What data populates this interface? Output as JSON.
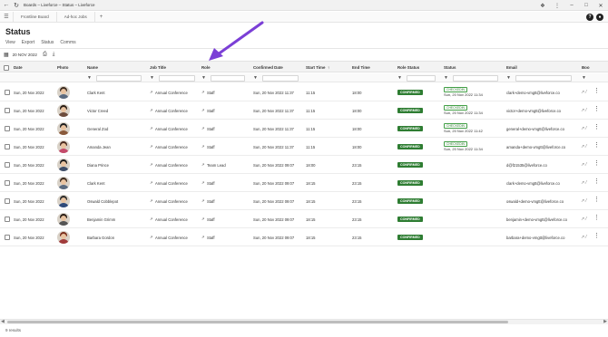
{
  "browser": {
    "title": "Boards – Liveforce – Status – Liveforce"
  },
  "app_tabs": [
    "Frontline Board",
    "Ad-hoc Jobs"
  ],
  "page": {
    "title": "Status",
    "subnav": [
      "View",
      "Export",
      "Status",
      "Comms"
    ],
    "date_filter": "20 NOV 2022"
  },
  "columns": [
    "Date",
    "Photo",
    "Name",
    "Job Title",
    "Role",
    "Confirmed Date",
    "Start Time",
    "End Time",
    "Role Status",
    "Status",
    "Email",
    "Boo"
  ],
  "rows": [
    {
      "date": "Sun, 20 Nov 2022",
      "name": "Clark Kent",
      "job": "Annual Conference",
      "role": "Staff",
      "confirmed": "Sun, 20 Nov 2022 11:37",
      "start": "11:15",
      "end": "18:00",
      "role_status": "CONFIRMED",
      "checked_in": true,
      "status_date": "Sun, 20 Nov 2022 11:34",
      "email": "clark+demo-vmgtt@liveforce.co",
      "photo_hair": "#3b2a1e",
      "photo_body": "#5b6b80"
    },
    {
      "date": "Sun, 20 Nov 2022",
      "name": "Victor Creed",
      "job": "Annual Conference",
      "role": "Staff",
      "confirmed": "Sun, 20 Nov 2022 11:37",
      "start": "11:15",
      "end": "18:00",
      "role_status": "CONFIRMED",
      "checked_in": true,
      "status_date": "Sun, 20 Nov 2022 11:34",
      "email": "victor+demo-vmgtt@liveforce.co",
      "photo_hair": "#2a1d14",
      "photo_body": "#6d4c3d"
    },
    {
      "date": "Sun, 20 Nov 2022",
      "name": "General Zod",
      "job": "Annual Conference",
      "role": "Staff",
      "confirmed": "Sun, 20 Nov 2022 11:37",
      "start": "11:15",
      "end": "18:00",
      "role_status": "CONFIRMED",
      "checked_in": true,
      "status_date": "Sun, 20 Nov 2022 11:42",
      "email": "general+demo-vmgtt@liveforce.co",
      "photo_hair": "#1e1e1e",
      "photo_body": "#8a5a3c"
    },
    {
      "date": "Sun, 20 Nov 2022",
      "name": "Amanda Jean",
      "job": "Annual Conference",
      "role": "Staff",
      "confirmed": "Sun, 20 Nov 2022 11:37",
      "start": "11:15",
      "end": "18:00",
      "role_status": "CONFIRMED",
      "checked_in": true,
      "status_date": "Sun, 20 Nov 2022 11:34",
      "email": "amanda+demo-vmgtt@liveforce.co",
      "photo_hair": "#4a2b1f",
      "photo_body": "#c44b6a"
    },
    {
      "date": "Sun, 20 Nov 2022",
      "name": "Diana Prince",
      "job": "Annual Conference",
      "role": "Team Lead",
      "confirmed": "Sun, 20 Nov 2022 09:07",
      "start": "18:00",
      "end": "23:15",
      "role_status": "CONFIRMED",
      "checked_in": false,
      "status_date": "",
      "email": "d@f21535@liveforce.co",
      "photo_hair": "#1b1b1b",
      "photo_body": "#3f4f6a"
    },
    {
      "date": "Sun, 20 Nov 2022",
      "name": "Clark Kent",
      "job": "Annual Conference",
      "role": "Staff",
      "confirmed": "Sun, 20 Nov 2022 09:07",
      "start": "18:15",
      "end": "23:15",
      "role_status": "CONFIRMED",
      "checked_in": false,
      "status_date": "",
      "email": "clark+demo-vmgtt@liveforce.co",
      "photo_hair": "#3b2a1e",
      "photo_body": "#5b6b80"
    },
    {
      "date": "Sun, 20 Nov 2022",
      "name": "Oswald Cobblepot",
      "job": "Annual Conference",
      "role": "Staff",
      "confirmed": "Sun, 20 Nov 2022 09:07",
      "start": "18:15",
      "end": "23:15",
      "role_status": "CONFIRMED",
      "checked_in": false,
      "status_date": "",
      "email": "oswald+demo-vmgtt@liveforce.co",
      "photo_hair": "#2b2b2b",
      "photo_body": "#2f4a7a"
    },
    {
      "date": "Sun, 20 Nov 2022",
      "name": "Benjamin Grimm",
      "job": "Annual Conference",
      "role": "Staff",
      "confirmed": "Sun, 20 Nov 2022 09:07",
      "start": "18:15",
      "end": "23:15",
      "role_status": "CONFIRMED",
      "checked_in": false,
      "status_date": "",
      "email": "benjamin+demo-vmgtt@liveforce.co",
      "photo_hair": "#2a1d14",
      "photo_body": "#555555"
    },
    {
      "date": "Sun, 20 Nov 2022",
      "name": "Barbara Gordon",
      "job": "Annual Conference",
      "role": "Staff",
      "confirmed": "Sun, 20 Nov 2022 09:07",
      "start": "18:15",
      "end": "23:15",
      "role_status": "CONFIRMED",
      "checked_in": false,
      "status_date": "",
      "email": "barbara+demo-vmgtt@liveforce.co",
      "photo_hair": "#7a2e1c",
      "photo_body": "#a13b3b"
    }
  ],
  "checked_in_label": "CHECKEDIN",
  "footer": "9 results",
  "colors": {
    "accent_arrow": "#7b3fd6",
    "confirmed_green": "#2e7d32"
  }
}
